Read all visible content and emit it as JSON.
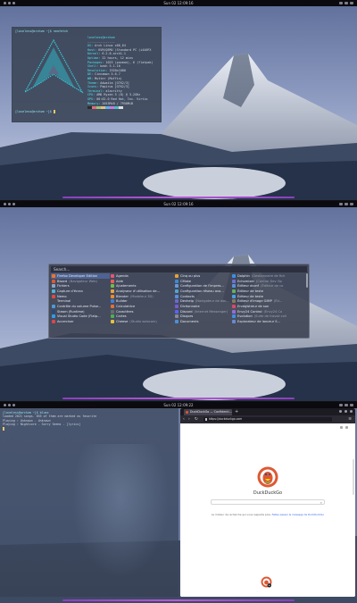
{
  "screens": [
    {
      "topbar": {
        "time": "Sun 02 12:09:16"
      },
      "terminal": {
        "prompt": "[loveless@archvm ~]$ neofetch",
        "prompt_end": "[loveless@archvm ~]$",
        "info_title": "loveless@archvm",
        "info_sep": "---------------",
        "info": [
          {
            "k": "OS:",
            "v": "Arch Linux x86_64"
          },
          {
            "k": "Host:",
            "v": "KVM/QEMU (Standard PC (i440FX"
          },
          {
            "k": "Kernel:",
            "v": "6.2.8-arch1-1"
          },
          {
            "k": "Uptime:",
            "v": "22 hours, 12 mins"
          },
          {
            "k": "Packages:",
            "v": "1023 (pacman), 6 (flatpak)"
          },
          {
            "k": "Shell:",
            "v": "bash 5.1.16"
          },
          {
            "k": "Resolution:",
            "v": "1920x1080"
          },
          {
            "k": "DE:",
            "v": "Cinnamon 5.6.7"
          },
          {
            "k": "WM:",
            "v": "Mutter (Muffin)"
          },
          {
            "k": "Theme:",
            "v": "Adwaita [GTK2/3]"
          },
          {
            "k": "Icons:",
            "v": "Papirus [GTK2/3]"
          },
          {
            "k": "Terminal:",
            "v": "alacritty"
          },
          {
            "k": "CPU:",
            "v": "AMD Ryzen 5 (8) @ 3.2GHz"
          },
          {
            "k": "GPU:",
            "v": "00:02.0 Red Hat, Inc. Virtio"
          },
          {
            "k": "Memory:",
            "v": "2053MiB / 7958MiB"
          }
        ],
        "swatch_colors": [
          "#2b2b2b",
          "#e06c75",
          "#98c379",
          "#e5c07b",
          "#61afef",
          "#c678dd",
          "#56b6c2",
          "#dcdfe4"
        ]
      }
    },
    {
      "topbar": {
        "time": "Sun 02 12:09:16"
      },
      "launcher": {
        "search_placeholder": "Search...",
        "items": [
          {
            "label": "Firefox Developer Edition",
            "sub": "",
            "color": "#f0742a",
            "selected": true
          },
          {
            "label": "Agenda",
            "sub": "",
            "color": "#e05a6e",
            "selected": false
          },
          {
            "label": "Cinq ou plus",
            "sub": "",
            "color": "#e2a33a",
            "selected": false
          },
          {
            "label": "Dolphin",
            "sub": "(Gestionnaire de fich",
            "color": "#3d8ee6",
            "selected": false
          },
          {
            "label": "Bisard",
            "sub": "(Navigateur Web)",
            "color": "#de5833",
            "selected": false
          },
          {
            "label": "Aide",
            "sub": "",
            "color": "#f25a5a",
            "selected": false
          },
          {
            "label": "CMake",
            "sub": "",
            "color": "#3b8bd1",
            "selected": false
          },
          {
            "label": "Echomixer",
            "sub": "(Control Dev Op",
            "color": "#6f6fd6",
            "selected": false
          },
          {
            "label": "Fichiers",
            "sub": "",
            "color": "#8aa6c8",
            "selected": false
          },
          {
            "label": "Ajustements",
            "sub": "",
            "color": "#6cbf4f",
            "selected": false
          },
          {
            "label": "Configuration de l'impres...",
            "sub": "",
            "color": "#6b9ad8",
            "selected": false
          },
          {
            "label": "Éditeur dconf",
            "sub": "(Éditeur de co",
            "color": "#5c8fd6",
            "selected": false
          },
          {
            "label": "Capture d'écran",
            "sub": "",
            "color": "#4fb4d8",
            "selected": false
          },
          {
            "label": "Analyseur d'utilisation de...",
            "sub": "",
            "color": "#e8a53d",
            "selected": false
          },
          {
            "label": "Configuration réseau ava...",
            "sub": "",
            "color": "#4aa8d0",
            "selected": false
          },
          {
            "label": "Éditeur de texte",
            "sub": "",
            "color": "#5fb35f",
            "selected": false
          },
          {
            "label": "Nemo",
            "sub": "",
            "color": "#e04848",
            "selected": false
          },
          {
            "label": "Blender",
            "sub": "(Modeleur 3D)",
            "color": "#ef8a2a",
            "selected": false
          },
          {
            "label": "Contacts",
            "sub": "",
            "color": "#5b8fdf",
            "selected": false
          },
          {
            "label": "Éditeur de texte",
            "sub": "",
            "color": "#4a9ee8",
            "selected": false
          },
          {
            "label": "Terminal",
            "sub": "",
            "color": "#4d4d4d",
            "selected": false
          },
          {
            "label": "Builder",
            "sub": "",
            "color": "#3f7fd6",
            "selected": false
          },
          {
            "label": "Devhelp",
            "sub": "(Navigateur de doc...",
            "color": "#6a6ad0",
            "selected": false
          },
          {
            "label": "Éditeur d'image GIMP",
            "sub": "(Éd...",
            "color": "#8a7a5a",
            "selected": false
          },
          {
            "label": "Contrôle du volume Pulse...",
            "sub": "",
            "color": "#4f9ad8",
            "selected": false
          },
          {
            "label": "Calculatrice",
            "sub": "",
            "color": "#e36f3a",
            "selected": false
          },
          {
            "label": "Dictionnaire",
            "sub": "",
            "color": "#7a5ad0",
            "selected": false
          },
          {
            "label": "Enregistreur de son",
            "sub": "",
            "color": "#d84a6a",
            "selected": false
          },
          {
            "label": "Steam (Runtime)",
            "sub": "",
            "color": "#2a4a7a",
            "selected": false
          },
          {
            "label": "Caractères",
            "sub": "",
            "color": "#6b6b6b",
            "selected": false
          },
          {
            "label": "Discord",
            "sub": "(Internet Messenger)",
            "color": "#5865f2",
            "selected": false
          },
          {
            "label": "Envy24 Control",
            "sub": "(Envy24 Co",
            "color": "#9a6ad8",
            "selected": false
          },
          {
            "label": "Visual Studio Code (Flatp...",
            "sub": "",
            "color": "#2f9ee6",
            "selected": false
          },
          {
            "label": "Cartes",
            "sub": "",
            "color": "#4fae5a",
            "selected": false
          },
          {
            "label": "Disques",
            "sub": "",
            "color": "#8a8a98",
            "selected": false
          },
          {
            "label": "Evolution",
            "sub": "(Suite de travail coll",
            "color": "#3f8fe0",
            "selected": false
          },
          {
            "label": "Accerciser",
            "sub": "",
            "color": "#d84848",
            "selected": false
          },
          {
            "label": "Cheese",
            "sub": "(Studio webcam)",
            "color": "#e8c23a",
            "selected": false
          },
          {
            "label": "Documents",
            "sub": "",
            "color": "#4f8fd8",
            "selected": false
          },
          {
            "label": "Explorateur de lanceur S...",
            "sub": "",
            "color": "#6a8ad0",
            "selected": false
          }
        ]
      }
    },
    {
      "topbar": {
        "time": "Sun 02 12:09:22"
      },
      "terminal": {
        "lines": [
          "[loveless@archvm ~]$ bluez",
          "loaded 2021 songs. 655 of them are marked as favorite",
          "Playing : Unknown - Unknown",
          "Playing : Nightcore - Sorry Seems - [lyrics]"
        ]
      },
      "browser": {
        "tab_title": "DuckDuckGo — Confidenti...",
        "url": "https://duckduckgo.com",
        "brand": "DuckDuckGo",
        "tagline_text": "Le moteur de recherche qui vous respecte plus.",
        "tagline_link": "Faites passer le message de DuckDuckGo",
        "newtab": "+",
        "back": "‹",
        "forward": "›",
        "reload": "↻",
        "menu": "≡",
        "search_icon": "⌕"
      }
    }
  ]
}
